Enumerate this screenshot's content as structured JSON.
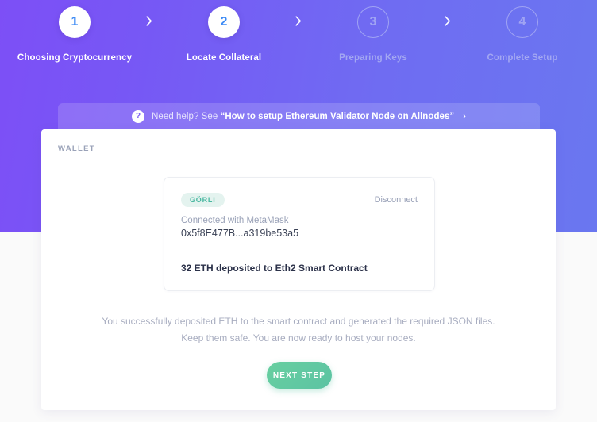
{
  "stepper": {
    "steps": [
      {
        "number": "1",
        "label": "Choosing Cryptocurrency",
        "state": "done"
      },
      {
        "number": "2",
        "label": "Locate Collateral",
        "state": "active"
      },
      {
        "number": "3",
        "label": "Preparing Keys",
        "state": "todo"
      },
      {
        "number": "4",
        "label": "Complete Setup",
        "state": "todo"
      }
    ],
    "separator_icon": "chevron-right-icon"
  },
  "help_banner": {
    "icon": "question-mark-icon",
    "icon_glyph": "?",
    "prefix": "Need help? See ",
    "link_text": "“How to setup Ethereum Validator Node on Allnodes”",
    "arrow_glyph": "›"
  },
  "main": {
    "section_title": "WALLET",
    "wallet": {
      "network_badge": "GÖRLI",
      "disconnect_label": "Disconnect",
      "connected_with": "Connected with MetaMask",
      "address": "0x5f8E477B...a319be53a5",
      "deposit_status": "32 ETH deposited to Eth2 Smart Contract"
    },
    "description": "You successfully deposited ETH to the smart contract and generated the required JSON files. Keep them safe. You are now ready to host your nodes.",
    "next_button_label": "NEXT STEP"
  },
  "colors": {
    "hero_gradient_start": "#7d4ff6",
    "hero_gradient_end": "#6a77f0",
    "page_background": "#fafafa",
    "step_number_active": "#3d8bf5",
    "step_todo": "#a0a4f3",
    "badge_background": "#e4f3ef",
    "badge_text": "#4ab8a1",
    "next_button": "#5cc3a3",
    "muted_text": "#9aa2b8"
  }
}
